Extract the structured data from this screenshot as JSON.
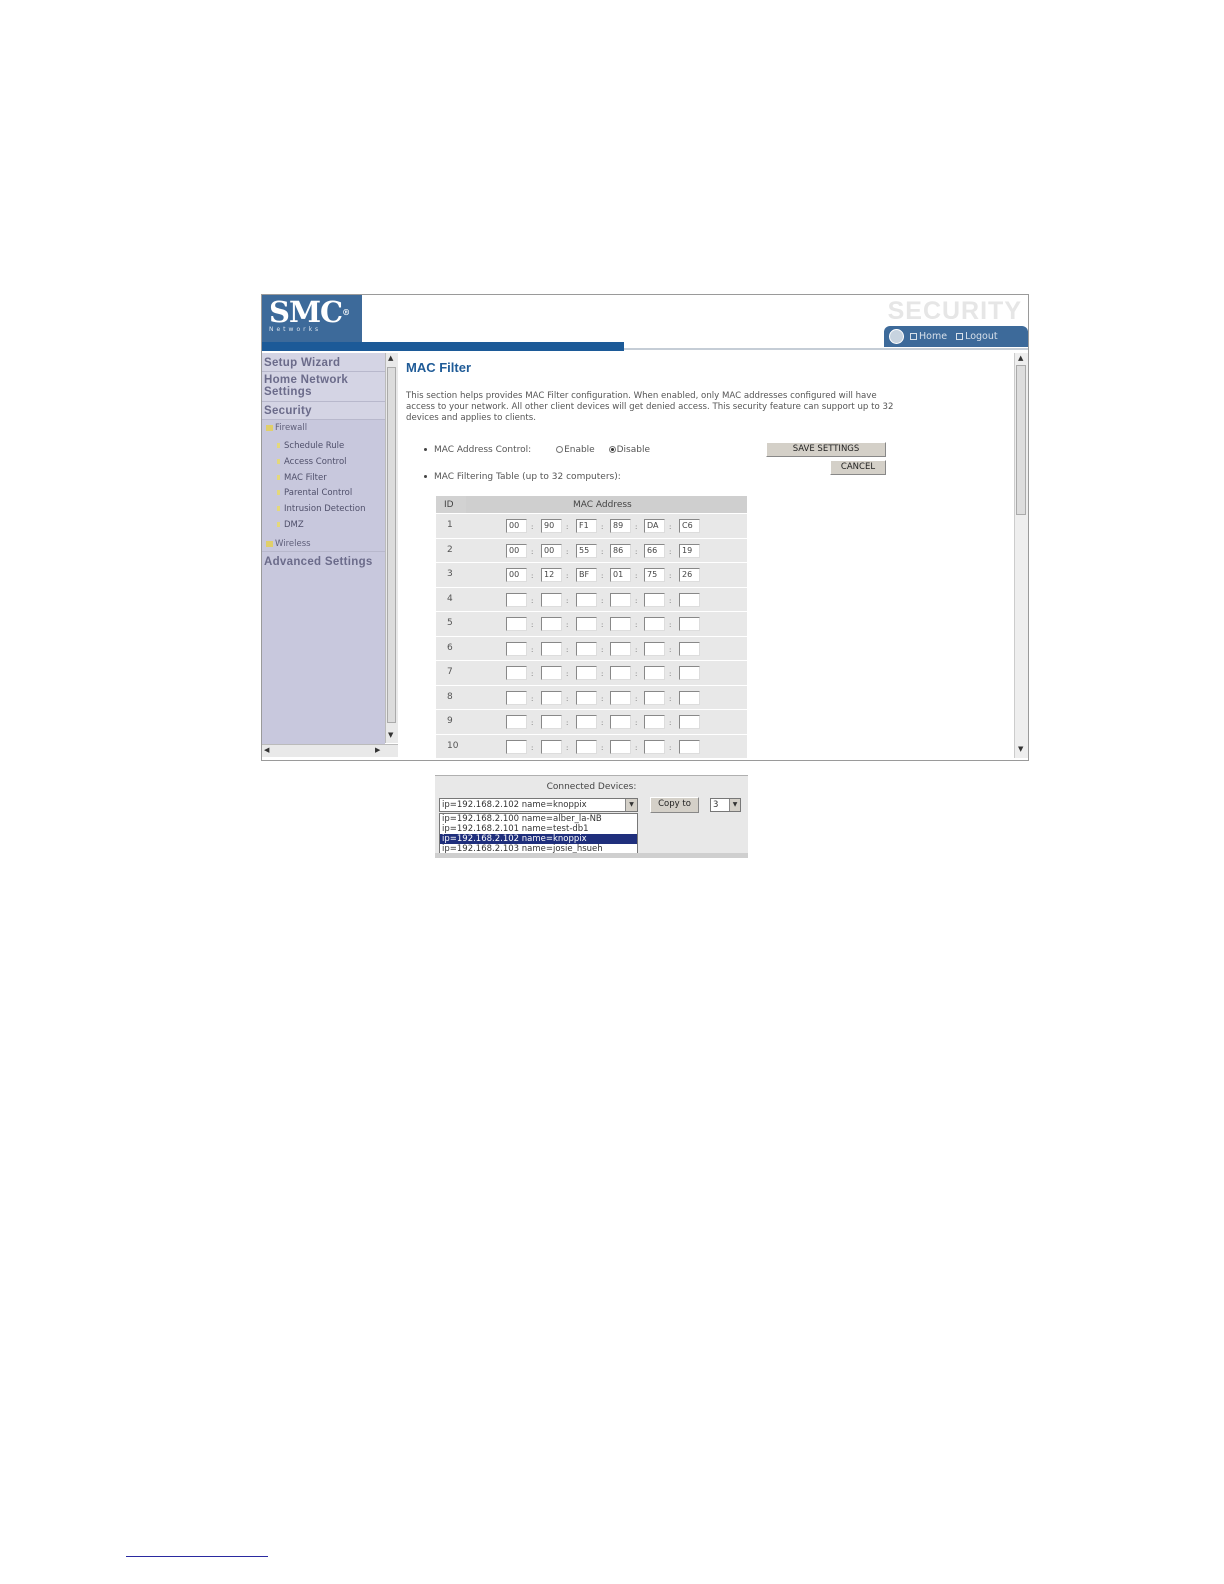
{
  "header": {
    "logo_text": "SMC",
    "logo_reg": "®",
    "logo_sub": "Networks",
    "section_title": "SECURITY",
    "nav": {
      "home": "Home",
      "logout": "Logout"
    }
  },
  "sidebar": {
    "items": [
      "Setup Wizard",
      "Home Network Settings",
      "Security",
      "Advanced Settings"
    ],
    "firewall": "Firewall",
    "firewall_items": [
      "Schedule Rule",
      "Access Control",
      "MAC Filter",
      "Parental Control",
      "Intrusion Detection",
      "DMZ"
    ],
    "wireless": "Wireless"
  },
  "main": {
    "title": "MAC Filter",
    "description": "This section helps provides MAC Filter configuration. When enabled, only MAC addresses configured will have access to your network. All other client devices will get denied access. This security feature can support up to 32 devices and applies to clients.",
    "mac_control_label": "MAC Address Control:",
    "enable_label": "Enable",
    "disable_label": "Disable",
    "mac_control_value": "Disable",
    "table_label": "MAC Filtering Table (up to 32 computers):",
    "save_label": "SAVE SETTINGS",
    "cancel_label": "CANCEL",
    "table": {
      "col_id": "ID",
      "col_mac": "MAC Address",
      "rows": [
        {
          "id": "1",
          "octets": [
            "00",
            "90",
            "F1",
            "89",
            "DA",
            "C6"
          ]
        },
        {
          "id": "2",
          "octets": [
            "00",
            "00",
            "55",
            "86",
            "66",
            "19"
          ]
        },
        {
          "id": "3",
          "octets": [
            "00",
            "12",
            "BF",
            "01",
            "75",
            "26"
          ]
        },
        {
          "id": "4",
          "octets": [
            "",
            "",
            "",
            "",
            "",
            ""
          ]
        },
        {
          "id": "5",
          "octets": [
            "",
            "",
            "",
            "",
            "",
            ""
          ]
        },
        {
          "id": "6",
          "octets": [
            "",
            "",
            "",
            "",
            "",
            ""
          ]
        },
        {
          "id": "7",
          "octets": [
            "",
            "",
            "",
            "",
            "",
            ""
          ]
        },
        {
          "id": "8",
          "octets": [
            "",
            "",
            "",
            "",
            "",
            ""
          ]
        },
        {
          "id": "9",
          "octets": [
            "",
            "",
            "",
            "",
            "",
            ""
          ]
        },
        {
          "id": "10",
          "octets": [
            "",
            "",
            "",
            "",
            "",
            ""
          ]
        }
      ]
    }
  },
  "devices": {
    "caption": "Connected Devices:",
    "selected": "ip=192.168.2.102 name=knoppix",
    "options": [
      "ip=192.168.2.100 name=alber_la-NB",
      "ip=192.168.2.101 name=test-db1",
      "ip=192.168.2.102 name=knoppix",
      "ip=192.168.2.103 name=josie_hsueh"
    ],
    "selected_index": 2,
    "copy_label": "Copy to",
    "copy_target": "3"
  },
  "colors": {
    "brand": "#3d6a9a",
    "accent_bar": "#1c5a98",
    "sidebar_bg": "#c8c8dd",
    "title_blue": "#1f5b97",
    "selected_option": "#1f2f7c"
  }
}
